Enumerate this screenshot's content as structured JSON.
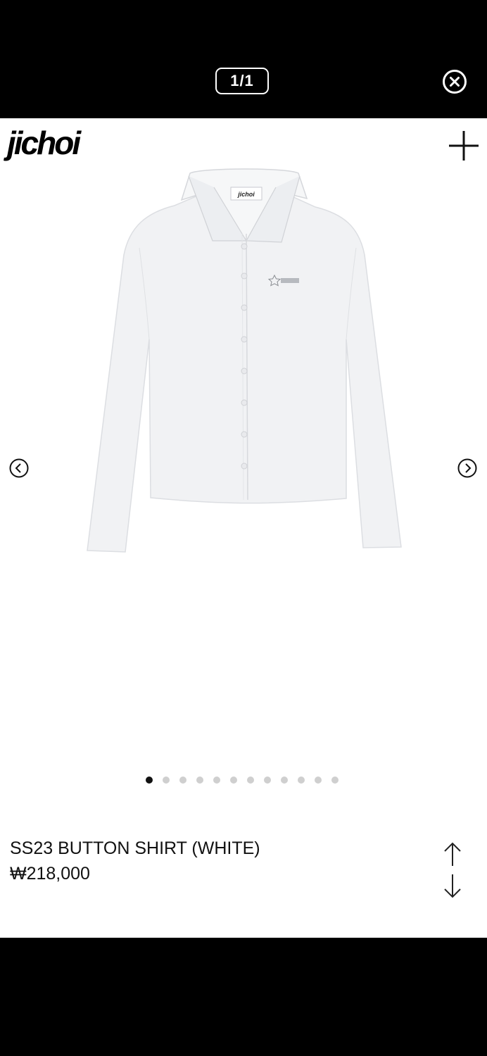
{
  "viewer": {
    "counter": "1/1"
  },
  "brand": {
    "logo": "jichoi"
  },
  "product": {
    "image_alt": "White long-sleeve button shirt",
    "label_text": "jichoi",
    "title": "SS23 BUTTON SHIRT (WHITE)",
    "price": "₩218,000"
  },
  "carousel": {
    "total_slides": 12,
    "active_index": 0
  },
  "icons": {
    "close": "close-icon",
    "add": "plus-icon",
    "prev": "chevron-left-icon",
    "next": "chevron-right-icon",
    "up": "arrow-up-icon",
    "down": "arrow-down-icon"
  }
}
